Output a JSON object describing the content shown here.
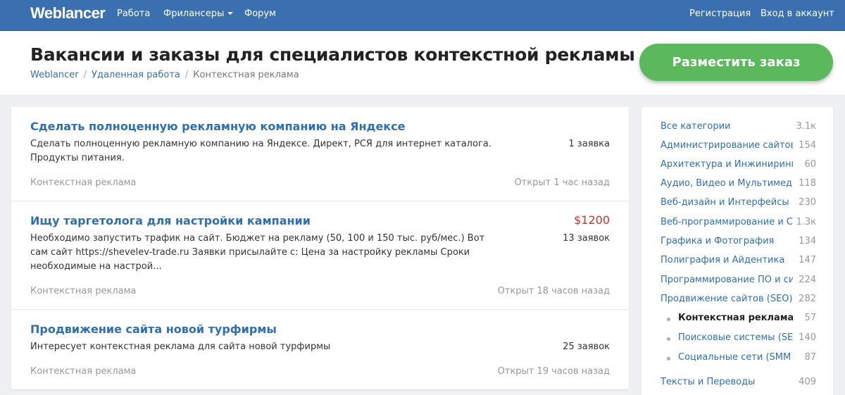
{
  "nav": {
    "logo": "Weblancer",
    "links": [
      "Работа",
      "Фрилансеры",
      "Форум"
    ],
    "register": "Регистрация",
    "login": "Вход в аккаунт"
  },
  "header": {
    "title": "Вакансии и заказы для специалистов контекстной рекламы",
    "breadcrumb": [
      "Weblancer",
      "Удаленная работа",
      "Контекстная реклама"
    ],
    "post_button": "Разместить заказ"
  },
  "jobs": [
    {
      "title": "Сделать полноценную рекламную компанию на Яндексе",
      "description": "Сделать полноценную рекламную компанию на Яндексе. Директ, РСЯ для интернет каталога. Продукты питания.",
      "bids": "1 заявка",
      "price": "",
      "category": "Контекстная реклама",
      "time": "Открыт 1 час назад"
    },
    {
      "title": "Ищу таргетолога для настройки кампании",
      "description": "Необходимо запустить трафик на сайт. Бюджет на рекламу (50, 100 и 150 тыс. руб/мес.) Вот сам сайт https://shevelev-trade.ru Заявки присылайте с: Цена за настройку рекламы Сроки необходимые на настрой...",
      "bids": "13 заявок",
      "price": "$1200",
      "category": "Контекстная реклама",
      "time": "Открыт 18 часов назад"
    },
    {
      "title": "Продвижение сайта новой турфирмы",
      "description": "Интересует контекстная реклама для сайта новой турфирмы",
      "bids": "25 заявок",
      "price": "",
      "category": "Контекстная реклама",
      "time": "Открыт 19 часов назад"
    }
  ],
  "sidebar": {
    "categories": [
      {
        "label": "Все категории",
        "count": "3.1к"
      },
      {
        "label": "Администрирование сайтов",
        "count": "154"
      },
      {
        "label": "Архитектура и Инжиниринг",
        "count": "60"
      },
      {
        "label": "Аудио, Видео и Мультимедиа",
        "count": "118"
      },
      {
        "label": "Веб-дизайн и Интерфейсы",
        "count": "230"
      },
      {
        "label": "Веб-программирование и Сайты",
        "count": "1.3к"
      },
      {
        "label": "Графика и Фотография",
        "count": "134"
      },
      {
        "label": "Полиграфия и Айдентика",
        "count": "147"
      },
      {
        "label": "Программирование ПО и систем",
        "count": "224"
      },
      {
        "label": "Продвижение сайтов (SEO)",
        "count": "282"
      }
    ],
    "subcategories": [
      {
        "label": "Контекстная реклама",
        "count": "57",
        "active": true
      },
      {
        "label": "Поисковые системы (SEO)",
        "count": "140"
      },
      {
        "label": "Социальные сети (SMM и SMO)",
        "count": "87"
      }
    ],
    "more": [
      {
        "label": "Тексты и Переводы",
        "count": "409"
      }
    ]
  }
}
